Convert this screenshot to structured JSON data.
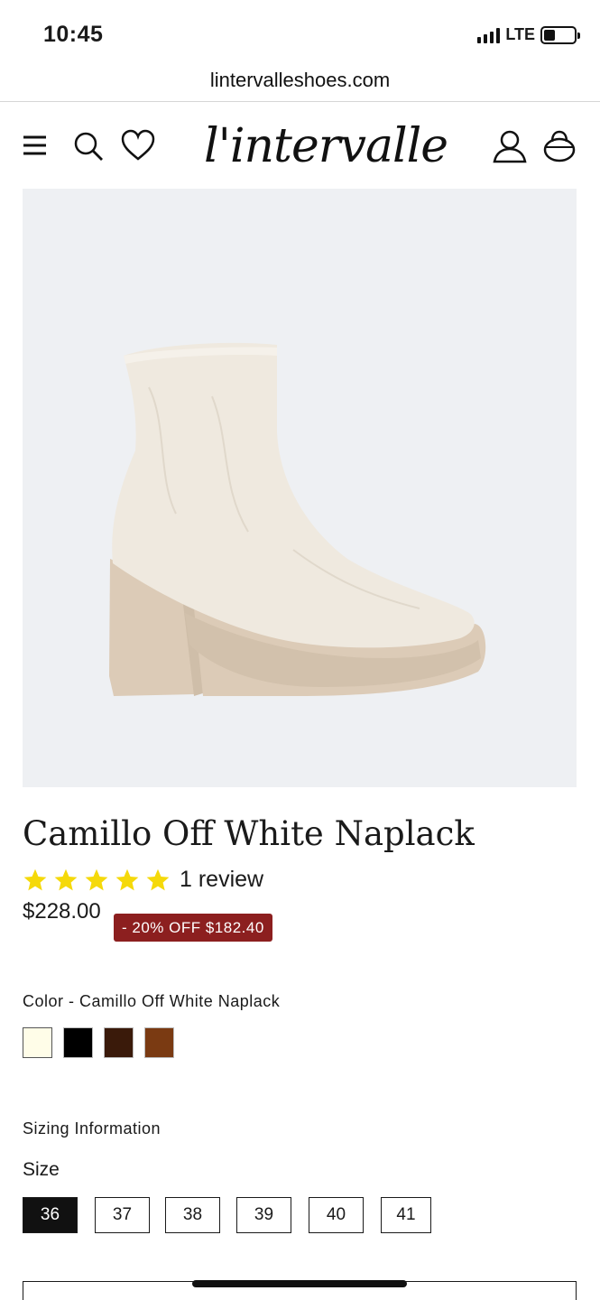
{
  "status_bar": {
    "time": "10:45",
    "network": "LTE",
    "battery_level": 0.3
  },
  "browser": {
    "url": "lintervalleshoes.com"
  },
  "header": {
    "logo": "l'intervalle",
    "icons": [
      "menu-icon",
      "search-icon",
      "heart-icon",
      "account-icon",
      "bag-icon"
    ]
  },
  "product": {
    "title": "Camillo Off White Naplack",
    "rating": 5,
    "review_count": "1 review",
    "price": "$228.00",
    "discount": "- 20% OFF $182.40",
    "color_label": "Color - Camillo Off White Naplack",
    "swatches": [
      {
        "name": "off-white",
        "color": "#fffde8"
      },
      {
        "name": "black",
        "color": "#000000"
      },
      {
        "name": "dark-brown",
        "color": "#3a1a0a"
      },
      {
        "name": "cognac",
        "color": "#7a3a12"
      }
    ],
    "sizing_info": "Sizing Information",
    "size_label": "Size",
    "sizes": [
      "36",
      "37",
      "38",
      "39",
      "40",
      "41"
    ],
    "selected_size": "36"
  },
  "colors": {
    "star": "#f5d90a",
    "discount_bg": "#8c1f1f",
    "image_bg": "#eef0f3",
    "boot": "#efe9df",
    "sole": "#dccbb7"
  }
}
